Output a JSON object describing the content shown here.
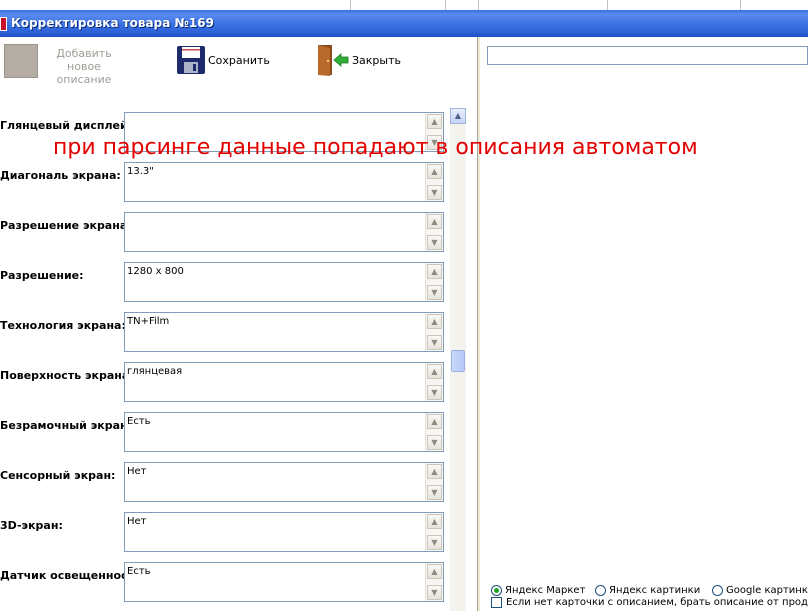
{
  "window": {
    "title": "Корректировка товара №169"
  },
  "toolbar": {
    "add_label": "Добавить новое описание",
    "save_label": "Сохранить",
    "close_label": "Закрыть"
  },
  "fields": [
    {
      "label": "Глянцевый дисплей:",
      "value": ""
    },
    {
      "label": "Диагональ экрана:",
      "value": "13.3\""
    },
    {
      "label": "Разрешение экрана:",
      "value": ""
    },
    {
      "label": "Разрешение:",
      "value": "1280 x 800"
    },
    {
      "label": "Технология экрана:",
      "value": "TN+Film"
    },
    {
      "label": "Поверхность экрана:",
      "value": "глянцевая"
    },
    {
      "label": "Безрамочный экран:",
      "value": "Есть"
    },
    {
      "label": "Сенсорный экран:",
      "value": "Нет"
    },
    {
      "label": "3D-экран:",
      "value": "Нет"
    },
    {
      "label": "Датчик освещенности",
      "value": "Есть"
    }
  ],
  "overlay_note": "при парсинге данные попадают в описания автоматом",
  "sources": {
    "options": [
      "Яндекс Маркет",
      "Яндекс картинки",
      "Google картинки"
    ],
    "selected": "Яндекс Маркет",
    "fallback_checkbox": "Если нет карточки с описанием, брать описание от продав"
  },
  "colors": {
    "titlebar": "#2b5fd6",
    "overlay_text": "#e30000",
    "field_border": "#7f9db9"
  },
  "icons": {
    "save": "floppy-disk-icon",
    "close": "door-exit-icon",
    "app": "app-icon"
  }
}
